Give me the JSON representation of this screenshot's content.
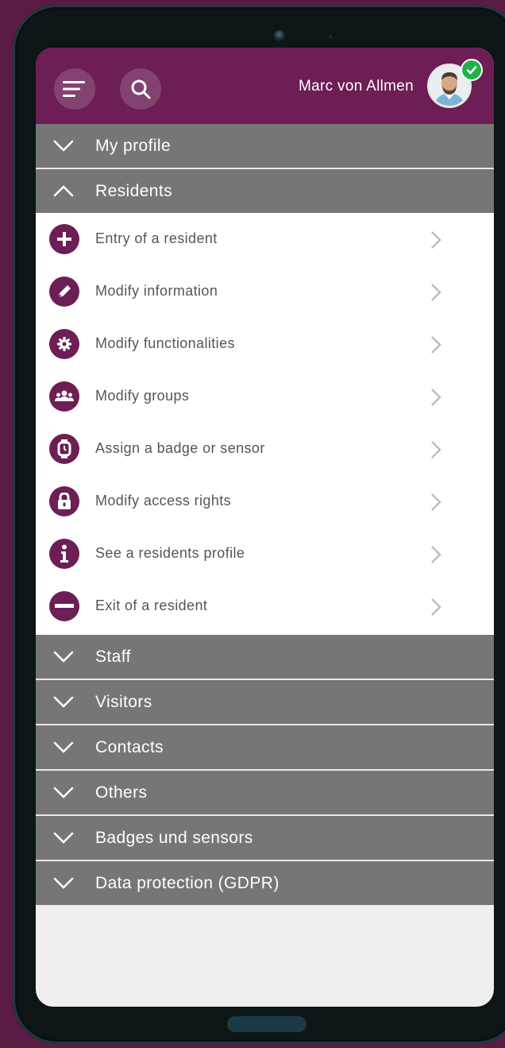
{
  "header": {
    "user_name": "Marc von Allmen",
    "accent_color": "#6d1e55",
    "menu_icon": "menu-icon",
    "search_icon": "search-icon",
    "status": "online-check"
  },
  "sections": {
    "my_profile": "My profile",
    "residents": "Residents",
    "staff": "Staff",
    "visitors": "Visitors",
    "contacts": "Contacts",
    "others": "Others",
    "badges": "Badges und sensors",
    "gdpr": "Data protection (GDPR)"
  },
  "resident_items": [
    {
      "label": "Entry of a resident",
      "icon": "plus-circle-icon"
    },
    {
      "label": "Modify information",
      "icon": "pencil-icon"
    },
    {
      "label": "Modify functionalities",
      "icon": "gear-icon"
    },
    {
      "label": "Modify groups",
      "icon": "group-icon"
    },
    {
      "label": "Assign a badge or sensor",
      "icon": "badge-watch-icon"
    },
    {
      "label": "Modify access rights",
      "icon": "lock-icon"
    },
    {
      "label": "See a residents profile",
      "icon": "info-icon"
    },
    {
      "label": "Exit of a resident",
      "icon": "minus-circle-icon"
    }
  ]
}
